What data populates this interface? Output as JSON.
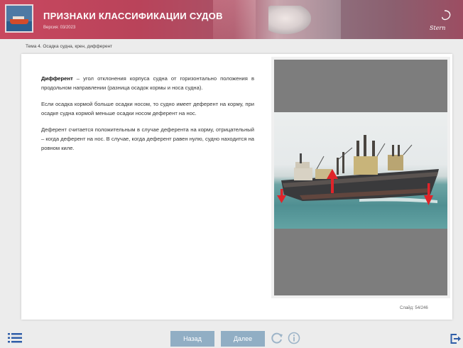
{
  "header": {
    "title": "ПРИЗНАКИ КЛАССИФИКАЦИИ СУДОВ",
    "version": "Версия: 03/2023",
    "brand_text": "Stern"
  },
  "breadcrumb": "Тема 4. Осадка судна, крен, дифферент",
  "content": {
    "p1_term": "Дифферент",
    "p1_rest": " – угол отклонения корпуса судна от горизонтально положения в продольном направлении (разница осадок кормы и носа судна).",
    "p2": "Если осадка кормой больше осадки носом, то судно имеет деферент на корму, при осадке судна кормой меньше осадки носом деферент на нос.",
    "p3": "Деферент считается положительным в случае деферента на корму, отрицательный – когда деферент на нос. В случае, когда деферент равен нулю, судно находится на ровном киле."
  },
  "slide_counter": "Слайд: 54/246",
  "nav": {
    "back": "Назад",
    "next": "Далее"
  },
  "icons": {
    "menu": "list-icon",
    "refresh": "refresh-icon",
    "info": "info-icon",
    "exit": "exit-icon"
  },
  "colors": {
    "header_accent": "#c8485f",
    "nav_button": "#91aec4",
    "arrow_red": "#e0242a"
  }
}
